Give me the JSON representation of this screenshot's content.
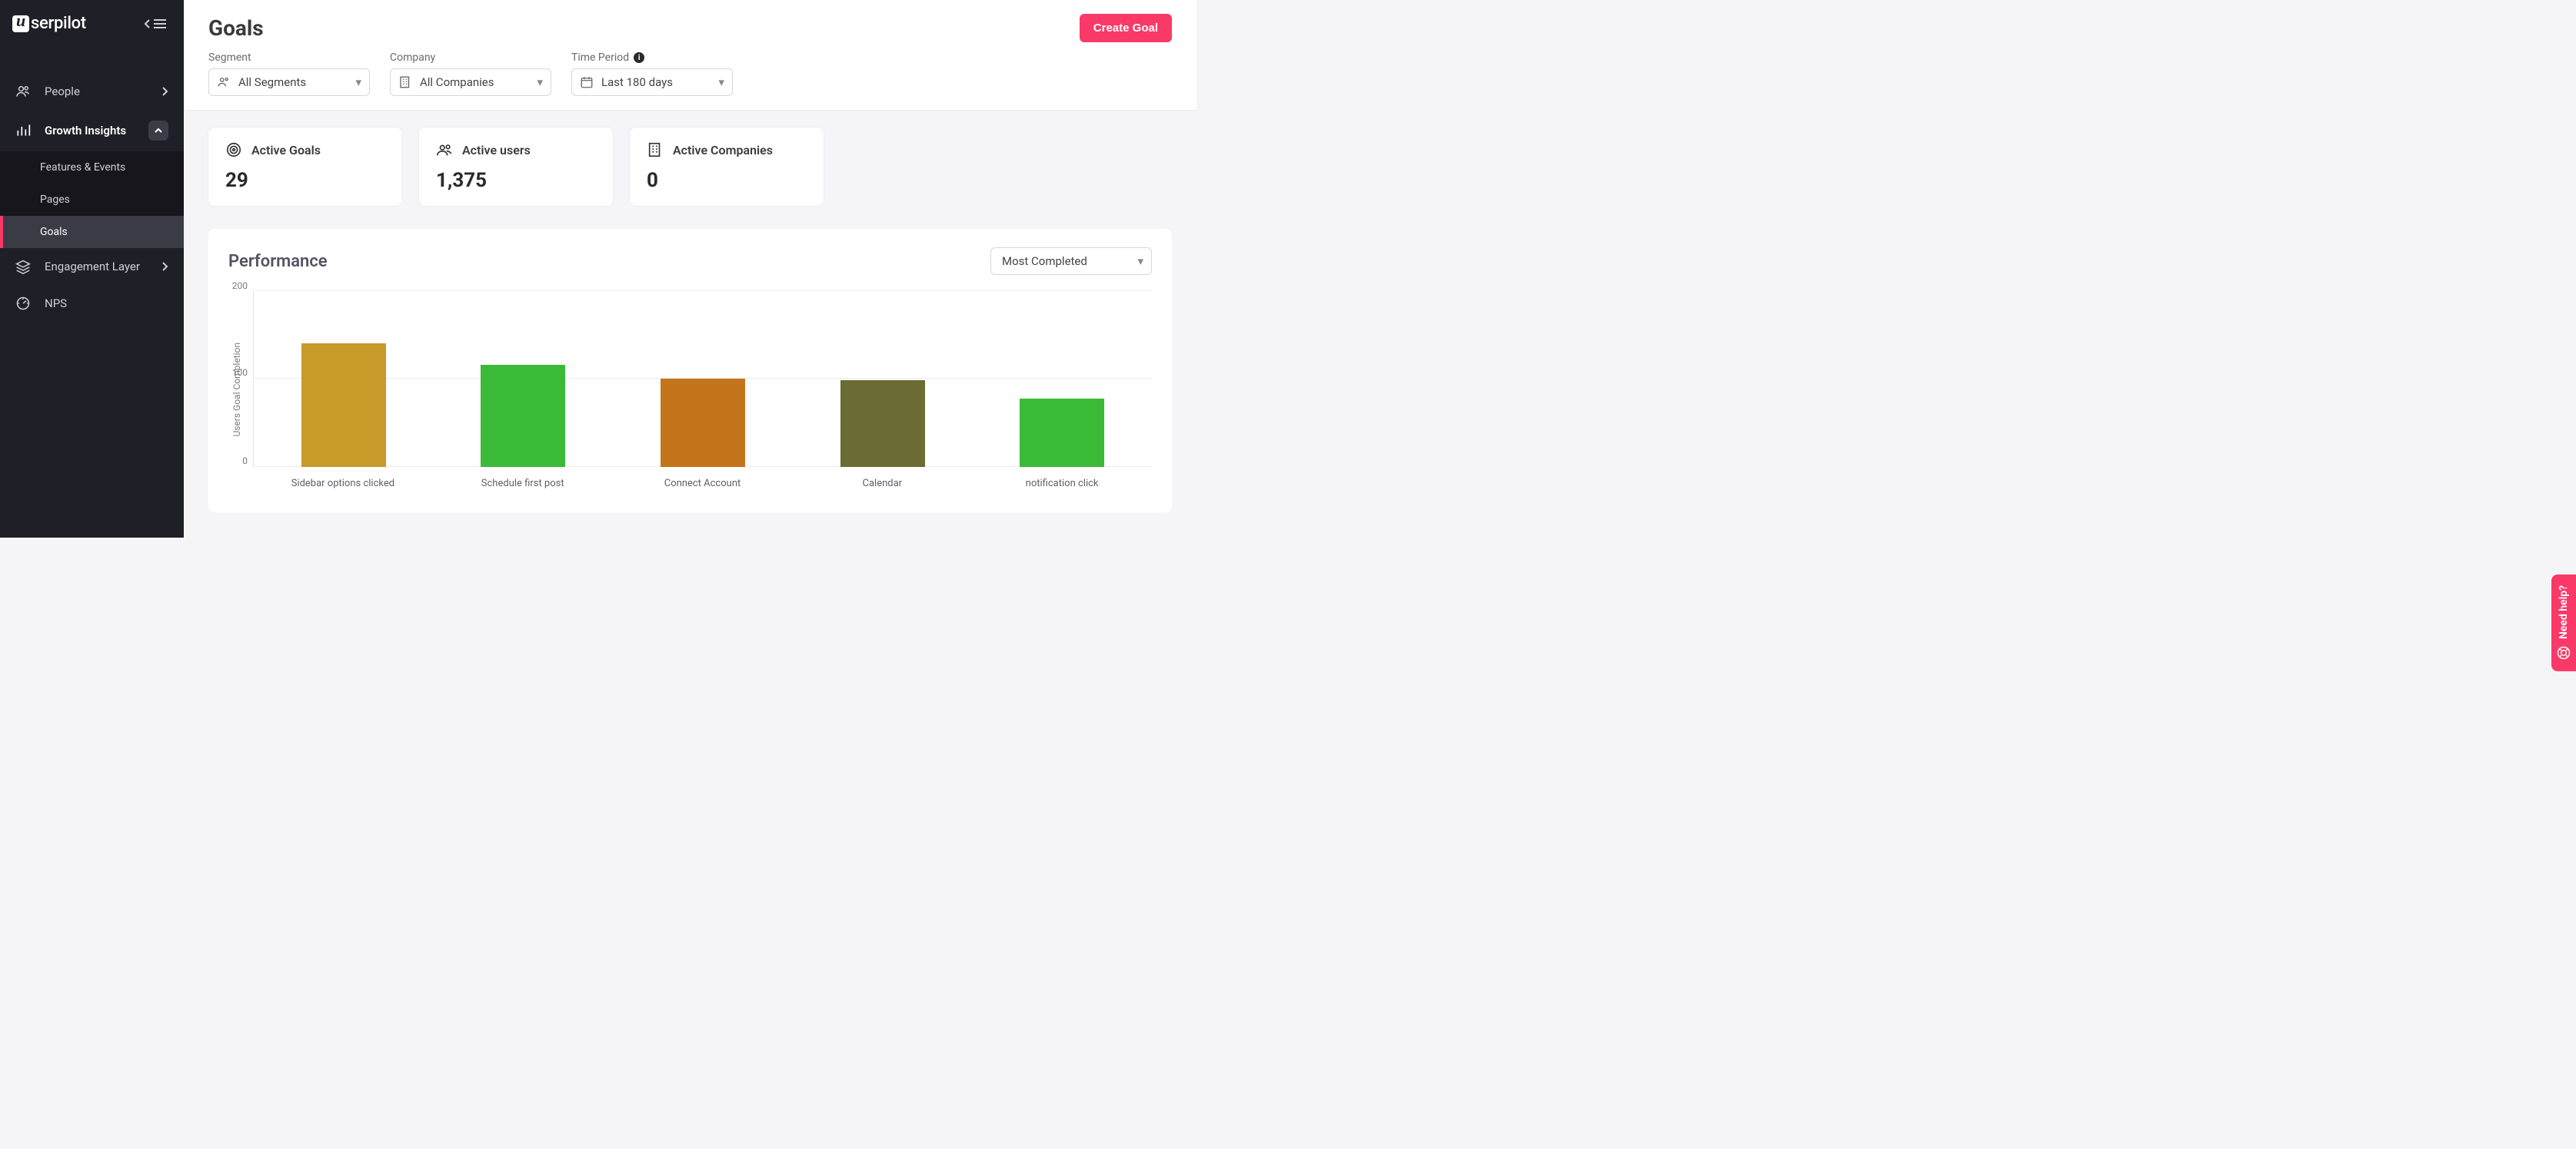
{
  "brand": "serpilot",
  "sidebar": {
    "items": [
      {
        "label": "People"
      },
      {
        "label": "Growth Insights",
        "children": [
          {
            "label": "Features & Events"
          },
          {
            "label": "Pages"
          },
          {
            "label": "Goals"
          }
        ]
      },
      {
        "label": "Engagement Layer"
      },
      {
        "label": "NPS"
      }
    ]
  },
  "page": {
    "title": "Goals",
    "create_btn": "Create Goal"
  },
  "filters": {
    "segment": {
      "label": "Segment",
      "value": "All Segments"
    },
    "company": {
      "label": "Company",
      "value": "All Companies"
    },
    "period": {
      "label": "Time Period",
      "value": "Last 180 days"
    }
  },
  "stats": {
    "active_goals": {
      "label": "Active Goals",
      "value": "29"
    },
    "active_users": {
      "label": "Active users",
      "value": "1,375"
    },
    "active_companies": {
      "label": "Active Companies",
      "value": "0"
    }
  },
  "performance": {
    "title": "Performance",
    "sort": "Most Completed",
    "ylabel": "Users Goal Completion"
  },
  "ticks": {
    "t0": "0",
    "t1": "100",
    "t2": "200"
  },
  "help": "Need help?",
  "colors": {
    "accent": "#fa3968"
  },
  "chart_data": {
    "type": "bar",
    "title": "Performance",
    "ylabel": "Users Goal Completion",
    "ylim": [
      0,
      200
    ],
    "ticks": [
      0,
      100,
      200
    ],
    "categories": [
      "Sidebar options clicked",
      "Schedule first post",
      "Connect Account",
      "Calendar",
      "notification click"
    ],
    "values": [
      140,
      116,
      100,
      98,
      77
    ],
    "bar_colors": [
      "#c89a2a",
      "#3bba38",
      "#c4741a",
      "#6b6b34",
      "#3bba38"
    ]
  }
}
